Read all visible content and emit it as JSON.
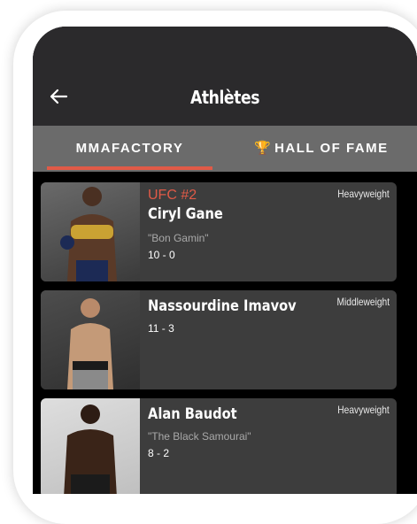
{
  "header": {
    "back_icon": "arrow-left-icon",
    "title": "Athlètes"
  },
  "tabs": [
    {
      "label": "MMAFACTORY",
      "active": true
    },
    {
      "label": "HALL OF FAME",
      "icon": "trophy-icon",
      "active": false
    }
  ],
  "colors": {
    "accent": "#e05a47",
    "header_bg": "#2b2a2c",
    "tabs_bg": "#6b6b6b",
    "card_bg": "#3d3d3d",
    "trophy": "#d9a41a"
  },
  "athletes": [
    {
      "rank": "UFC #2",
      "name": "Ciryl Gane",
      "nickname": "\"Bon Gamin\"",
      "record": "10 - 0",
      "weight_class": "Heavyweight"
    },
    {
      "rank": "",
      "name": "Nassourdine Imavov",
      "nickname": "",
      "record": "11 - 3",
      "weight_class": "Middleweight"
    },
    {
      "rank": "",
      "name": "Alan Baudot",
      "nickname": "\"The Black Samourai\"",
      "record": "8 - 2",
      "weight_class": "Heavyweight"
    }
  ]
}
